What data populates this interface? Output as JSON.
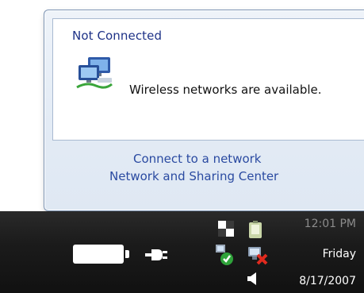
{
  "flyout": {
    "status_title": "Not Connected",
    "status_icon": "wireless-network-computers-icon",
    "status_message": "Wireless networks are available.",
    "links": {
      "connect": "Connect to a network",
      "sharing_center": "Network and Sharing Center"
    }
  },
  "taskbar": {
    "tray_icons": [
      "battery-icon",
      "power-plug-icon",
      "checker-icon",
      "security-shield-icon",
      "tablet-icon",
      "network-error-icon",
      "speaker-icon"
    ],
    "clock": {
      "time": "12:01 PM",
      "day": "Friday",
      "date": "8/17/2007"
    }
  },
  "colors": {
    "link": "#2a4aa1",
    "title": "#1e3287",
    "taskbar": "#1b1b1b",
    "flyout_frame": "#dfe8f3"
  }
}
